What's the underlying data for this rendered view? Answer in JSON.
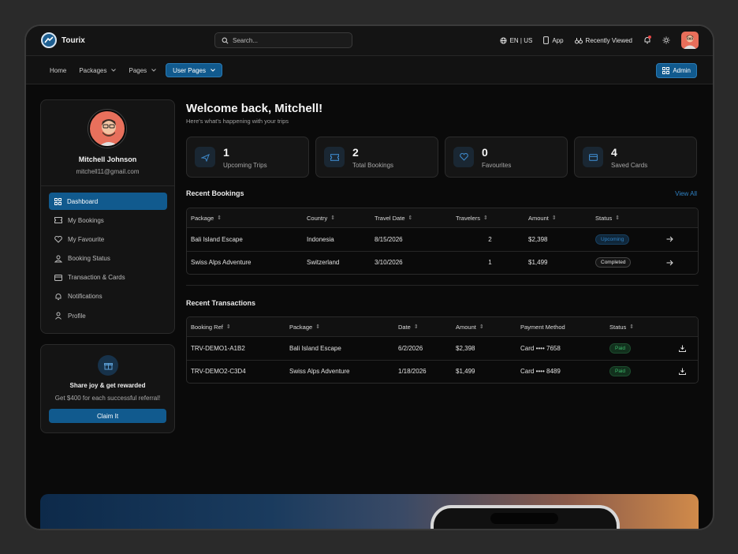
{
  "app": {
    "name": "Tourix"
  },
  "search": {
    "placeholder": "Search..."
  },
  "topbar": {
    "language": "EN | US",
    "app_label": "App",
    "recently_viewed": "Recently Viewed"
  },
  "nav": {
    "items": [
      {
        "label": "Home"
      },
      {
        "label": "Packages"
      },
      {
        "label": "Pages"
      },
      {
        "label": "User Pages"
      }
    ],
    "admin_label": "Admin"
  },
  "profile": {
    "name": "Mitchell Johnson",
    "email": "mitchell11@gmail.com"
  },
  "sidebar": {
    "items": [
      {
        "label": "Dashboard",
        "icon": "grid-icon"
      },
      {
        "label": "My Bookings",
        "icon": "ticket-icon"
      },
      {
        "label": "My Favourite",
        "icon": "heart-icon"
      },
      {
        "label": "Booking Status",
        "icon": "user-status-icon"
      },
      {
        "label": "Transaction & Cards",
        "icon": "card-icon"
      },
      {
        "label": "Notifications",
        "icon": "bell-icon"
      },
      {
        "label": "Profile",
        "icon": "user-icon"
      }
    ]
  },
  "promo": {
    "title": "Share joy & get rewarded",
    "subtitle": "Get $400 for each successful referral!",
    "button": "Claim It"
  },
  "welcome": {
    "title": "Welcome back, Mitchell!",
    "subtitle": "Here's what's happening with your trips"
  },
  "stats": [
    {
      "value": "1",
      "label": "Upcoming Trips"
    },
    {
      "value": "2",
      "label": "Total Bookings"
    },
    {
      "value": "0",
      "label": "Favourites"
    },
    {
      "value": "4",
      "label": "Saved Cards"
    }
  ],
  "bookings": {
    "title": "Recent Bookings",
    "view_all": "View All",
    "headers": [
      "Package",
      "Country",
      "Travel Date",
      "Travelers",
      "Amount",
      "Status"
    ],
    "rows": [
      {
        "package": "Bali Island Escape",
        "country": "Indonesia",
        "date": "8/15/2026",
        "travelers": "2",
        "amount": "$2,398",
        "status": "Upcoming"
      },
      {
        "package": "Swiss Alps Adventure",
        "country": "Switzerland",
        "date": "3/10/2026",
        "travelers": "1",
        "amount": "$1,499",
        "status": "Completed"
      }
    ]
  },
  "transactions": {
    "title": "Recent Transactions",
    "headers": [
      "Booking Ref",
      "Package",
      "Date",
      "Amount",
      "Payment Method",
      "Status"
    ],
    "rows": [
      {
        "ref": "TRV-DEMO1-A1B2",
        "package": "Bali Island Escape",
        "date": "6/2/2026",
        "amount": "$2,398",
        "method": "Card •••• 7658",
        "status": "Paid"
      },
      {
        "ref": "TRV-DEMO2-C3D4",
        "package": "Swiss Alps Adventure",
        "date": "1/18/2026",
        "amount": "$1,499",
        "method": "Card •••• 8489",
        "status": "Paid"
      }
    ]
  },
  "colors": {
    "accent": "#115a8e",
    "link": "#2f82c4",
    "paid": "#3cb86a"
  }
}
